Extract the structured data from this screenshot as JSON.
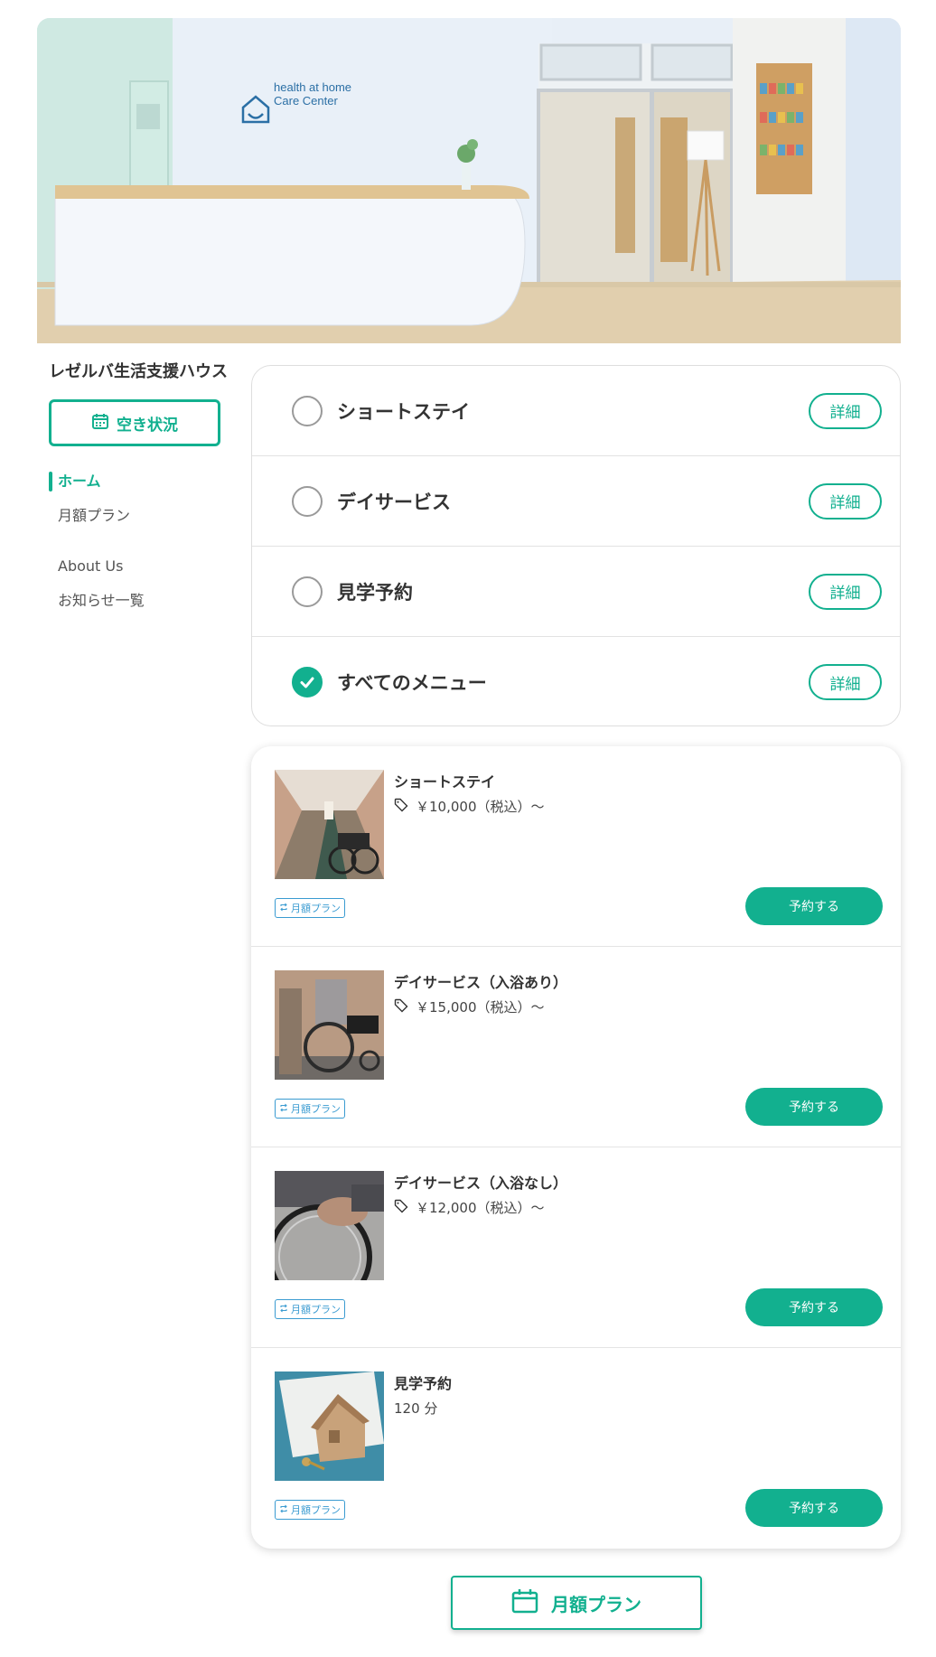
{
  "hero": {
    "sign_line1": "health at home",
    "sign_line2": "Care Center"
  },
  "sidebar": {
    "facility_name": "レゼルバ生活支援ハウス",
    "availability_label": "空き状況",
    "nav": [
      {
        "label": "ホーム",
        "active": true
      },
      {
        "label": "月額プラン",
        "active": false
      },
      {
        "label": "About Us",
        "active": false
      },
      {
        "label": "お知らせ一覧",
        "active": false
      }
    ]
  },
  "categories": [
    {
      "label": "ショートステイ",
      "checked": false,
      "detail": "詳細"
    },
    {
      "label": "デイサービス",
      "checked": false,
      "detail": "詳細"
    },
    {
      "label": "見学予約",
      "checked": false,
      "detail": "詳細"
    },
    {
      "label": "すべてのメニュー",
      "checked": true,
      "detail": "詳細"
    }
  ],
  "services": [
    {
      "title": "ショートステイ",
      "meta": "￥10,000（税込）〜",
      "tag": "月額プラン",
      "button": "予約する"
    },
    {
      "title": "デイサービス（入浴あり）",
      "meta": "￥15,000（税込）〜",
      "tag": "月額プラン",
      "button": "予約する"
    },
    {
      "title": "デイサービス（入浴なし）",
      "meta": "￥12,000（税込）〜",
      "tag": "月額プラン",
      "button": "予約する"
    },
    {
      "title": "見学予約",
      "meta": "120 分",
      "tag": "月額プラン",
      "button": "予約する"
    }
  ],
  "bottom_button": {
    "label": "月額プラン"
  },
  "colors": {
    "accent": "#12b08f",
    "tag_blue": "#3a9bd1"
  }
}
